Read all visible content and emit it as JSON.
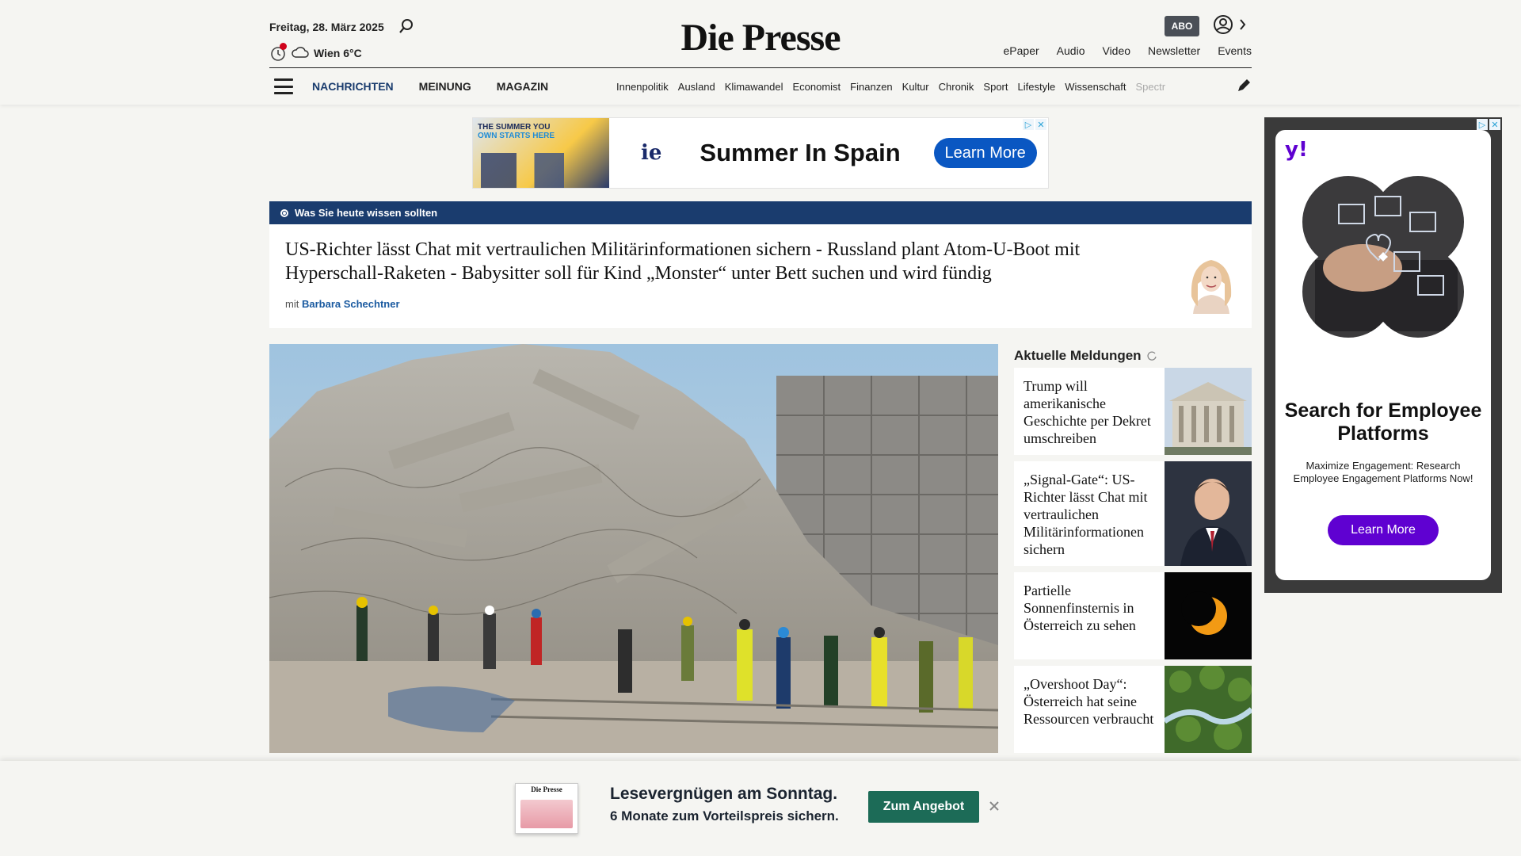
{
  "header": {
    "date": "Freitag, 28. März 2025",
    "weather": "Wien 6°C",
    "logo": "Die Presse",
    "abo_label": "ABO",
    "service_links": [
      "ePaper",
      "Audio",
      "Video",
      "Newsletter",
      "Events"
    ]
  },
  "nav": {
    "main": [
      "NACHRICHTEN",
      "MEINUNG",
      "MAGAZIN"
    ],
    "sub": [
      "Innenpolitik",
      "Ausland",
      "Klimawandel",
      "Economist",
      "Finanzen",
      "Kultur",
      "Chronik",
      "Sport",
      "Lifestyle",
      "Wissenschaft",
      "Spectr"
    ]
  },
  "top_ad": {
    "thumb_line1": "THE SUMMER YOU",
    "thumb_line2": "OWN STARTS HERE",
    "brand": "ie",
    "headline": "Summer In Spain",
    "cta": "Learn More"
  },
  "briefing": {
    "label": "Was Sie heute wissen sollten",
    "text": "US-Richter lässt Chat mit vertraulichen Militärinformationen sichern - Russland plant Atom-U-Boot mit Hyperschall-Raketen - Babysitter soll für Kind „Monster“ unter Bett suchen und wird fündig",
    "by_prefix": "mit",
    "author": "Barbara Schechtner"
  },
  "aktuell": {
    "title": "Aktuelle Meldungen",
    "items": [
      {
        "title": "Trump will amerikanische Geschichte per Dekret umschreiben"
      },
      {
        "title": "„Signal-Gate“: US-Richter lässt Chat mit vertraulichen Militärinformationen sichern"
      },
      {
        "title": "Partielle Sonnenfinsternis in Österreich zu sehen"
      },
      {
        "title": "„Overshoot Day“: Österreich hat seine Ressourcen verbraucht"
      }
    ]
  },
  "side_ad": {
    "brand": "y!",
    "headline": "Search for Employee Platforms",
    "sub": "Maximize Engagement: Research Employee Engagement Platforms Now!",
    "cta": "Learn More"
  },
  "promo": {
    "mag_title": "Die Presse",
    "headline": "Lesevergnügen am Sonntag.",
    "sub": "6 Monate zum Vorteilspreis sichern.",
    "cta": "Zum Angebot"
  },
  "colors": {
    "brand_blue": "#1a3c6e",
    "promo_green": "#1c6b57",
    "ad_blue": "#0a57c2",
    "yahoo_purple": "#5f01d1"
  }
}
